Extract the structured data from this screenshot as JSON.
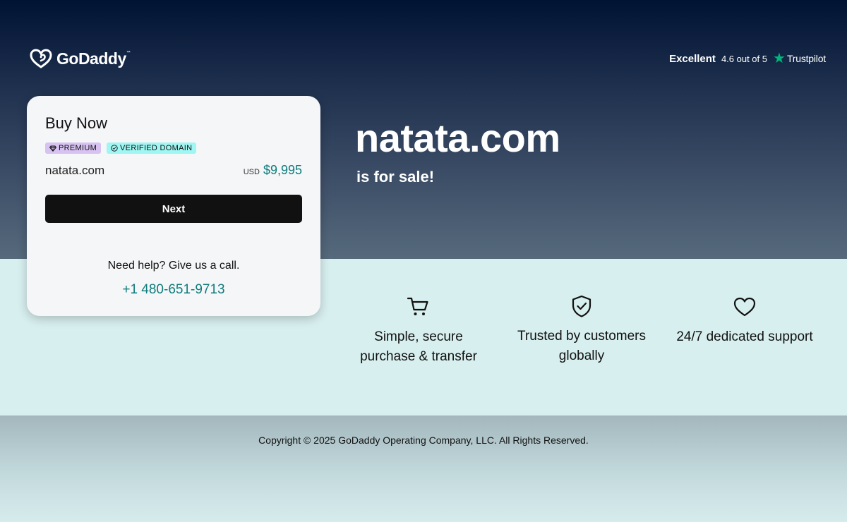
{
  "header": {
    "logo_text": "GoDaddy",
    "logo_tm": "™",
    "trustpilot": {
      "label": "Excellent",
      "rating": "4.6 out of 5",
      "brand": "Trustpilot"
    }
  },
  "hero": {
    "domain": "natata.com",
    "tagline": "is for sale!"
  },
  "card": {
    "title": "Buy Now",
    "badges": {
      "premium": "PREMIUM",
      "verified": "VERIFIED DOMAIN"
    },
    "domain": "natata.com",
    "currency": "USD",
    "price": "$9,995",
    "next_label": "Next",
    "help_text": "Need help? Give us a call.",
    "phone": "+1 480-651-9713"
  },
  "features": [
    {
      "icon": "cart-icon",
      "label_line1": "Simple, secure",
      "label_line2": "purchase & transfer"
    },
    {
      "icon": "shield-check-icon",
      "label_line1": "Trusted by customers",
      "label_line2": "globally"
    },
    {
      "icon": "heart-icon",
      "label_line1": "24/7 dedicated support",
      "label_line2": ""
    }
  ],
  "footer": {
    "copyright": "Copyright © 2025 GoDaddy Operating Company, LLC. All Rights Reserved."
  },
  "colors": {
    "accent_teal": "#0e7c7b",
    "trustpilot_green": "#00b67a",
    "button_bg": "#111111",
    "premium_badge": "#d7c2f2",
    "verified_badge": "#9ff6f2"
  }
}
